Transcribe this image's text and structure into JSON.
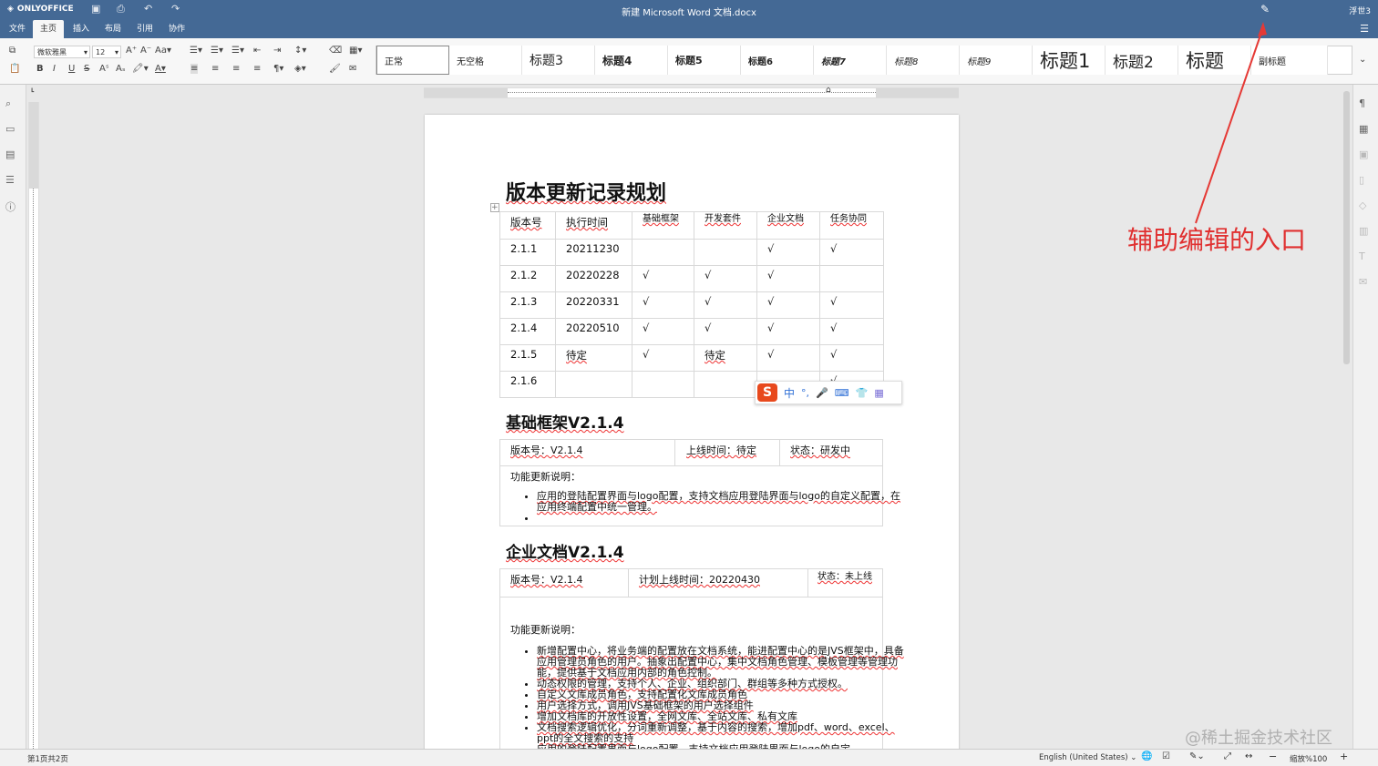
{
  "app": {
    "logo_text": "ONLYOFFICE",
    "doc_title": "新建 Microsoft Word 文档.docx",
    "user": "浮世3"
  },
  "menu": {
    "tabs": [
      "文件",
      "主页",
      "插入",
      "布局",
      "引用",
      "协作"
    ],
    "active_index": 1
  },
  "toolbar": {
    "font_name": "微软雅黑",
    "font_size": "12",
    "styles": [
      "正常",
      "无空格",
      "标题3",
      "标题4",
      "标题5",
      "标题6",
      "标题7",
      "标题8",
      "标题9",
      "标题1",
      "标题2",
      "标题",
      "副标题"
    ]
  },
  "document": {
    "title": "版本更新记录规划",
    "table1": {
      "headers": [
        "版本号",
        "执行时间",
        "基础框架",
        "开发套件",
        "企业文档",
        "任务协同"
      ],
      "rows": [
        [
          "2.1.1",
          "20211230",
          "",
          "",
          "√",
          "√"
        ],
        [
          "2.1.2",
          "20220228",
          "√",
          "√",
          "√",
          ""
        ],
        [
          "2.1.3",
          "20220331",
          "√",
          "√",
          "√",
          "√"
        ],
        [
          "2.1.4",
          "20220510",
          "√",
          "√",
          "√",
          "√"
        ],
        [
          "2.1.5",
          "待定",
          "√",
          "待定",
          "√",
          "√"
        ],
        [
          "2.1.6",
          "",
          "",
          "",
          "",
          "√"
        ]
      ]
    },
    "section1": {
      "heading": "基础框架V2.1.4",
      "version": "版本号：V2.1.4",
      "online": "上线时间：待定",
      "status": "状态：研发中",
      "desc_label": "功能更新说明：",
      "bullets": [
        "应用的登陆配置界面与logo配置，支持文档应用登陆界面与logo的自定义配置，在应用终端配置中统一管理。",
        ""
      ]
    },
    "section2": {
      "heading": "企业文档V2.1.4",
      "version": "版本号：V2.1.4",
      "online": "计划上线时间：20220430",
      "status": "状态：未上线",
      "desc_label": "功能更新说明：",
      "bullets": [
        "新增配置中心，将业务端的配置放在文档系统，能进配置中心的是JVS框架中，具备应用管理员角色的用户。抽象出配置中心，集中文档角色管理、模板管理等管理功能，提供基于文档应用内部的角色控制。",
        "动态权限的管理，支持个人、企业、组织部门、群组等多种方式授权。",
        "自定义文库成员角色，支持配置化文库成员角色",
        "用户选择方式，调用JVS基础框架的用户选择组件",
        "增加文档库的开放性设置，全网文库、全站文库、私有文库",
        "文档搜索逻辑优化，分词重新调整，基于内容的搜索，增加pdf、word、excel、ppt的全文搜索的支持",
        "应用的登陆配置界面与logo配置，支持文档应用登陆界面与logo的自定"
      ]
    }
  },
  "statusbar": {
    "page_info": "第1页共2页",
    "language": "English (United States)",
    "zoom": "缩放%100"
  },
  "annotation": "辅助编辑的入口",
  "watermark": "@稀土掘金技术社区",
  "ime": {
    "lang": "中"
  },
  "colors": {
    "header_bg": "#446995",
    "annotation": "#e03030"
  }
}
